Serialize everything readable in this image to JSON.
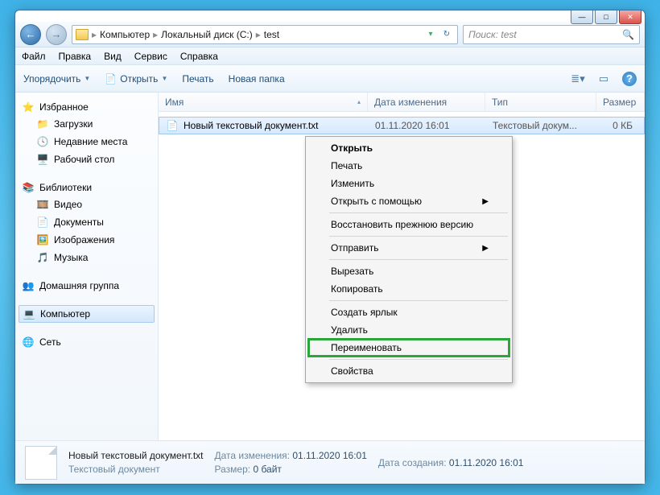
{
  "window": {
    "minimize": "—",
    "maximize": "□",
    "close": "✕"
  },
  "nav": {
    "back": "←",
    "forward": "→",
    "crumbs": [
      "Компьютер",
      "Локальный диск (C:)",
      "test"
    ],
    "refresh": "↻"
  },
  "search": {
    "placeholder": "Поиск: test",
    "icon": "🔍"
  },
  "menubar": [
    "Файл",
    "Правка",
    "Вид",
    "Сервис",
    "Справка"
  ],
  "toolbar": {
    "organize": "Упорядочить",
    "open": "Открыть",
    "print": "Печать",
    "newfolder": "Новая папка",
    "views": "≣",
    "preview": "▭",
    "help": "?"
  },
  "sidebar": {
    "favorites": {
      "label": "Избранное",
      "items": [
        "Загрузки",
        "Недавние места",
        "Рабочий стол"
      ]
    },
    "libraries": {
      "label": "Библиотеки",
      "items": [
        "Видео",
        "Документы",
        "Изображения",
        "Музыка"
      ]
    },
    "homegroup": {
      "label": "Домашняя группа"
    },
    "computer": {
      "label": "Компьютер"
    },
    "network": {
      "label": "Сеть"
    }
  },
  "columns": {
    "name": "Имя",
    "date": "Дата изменения",
    "type": "Тип",
    "size": "Размер"
  },
  "file": {
    "name": "Новый текстовый документ.txt",
    "date": "01.11.2020 16:01",
    "type": "Текстовый докум...",
    "size": "0 КБ"
  },
  "context": {
    "open": "Открыть",
    "print": "Печать",
    "edit": "Изменить",
    "openwith": "Открыть с помощью",
    "restore": "Восстановить прежнюю версию",
    "sendto": "Отправить",
    "cut": "Вырезать",
    "copy": "Копировать",
    "shortcut": "Создать ярлык",
    "delete": "Удалить",
    "rename": "Переименовать",
    "properties": "Свойства"
  },
  "details": {
    "title": "Новый текстовый документ.txt",
    "subtitle": "Текстовый документ",
    "date_label": "Дата изменения:",
    "date": "01.11.2020 16:01",
    "size_label": "Размер:",
    "size": "0 байт",
    "created_label": "Дата создания:",
    "created": "01.11.2020 16:01"
  }
}
